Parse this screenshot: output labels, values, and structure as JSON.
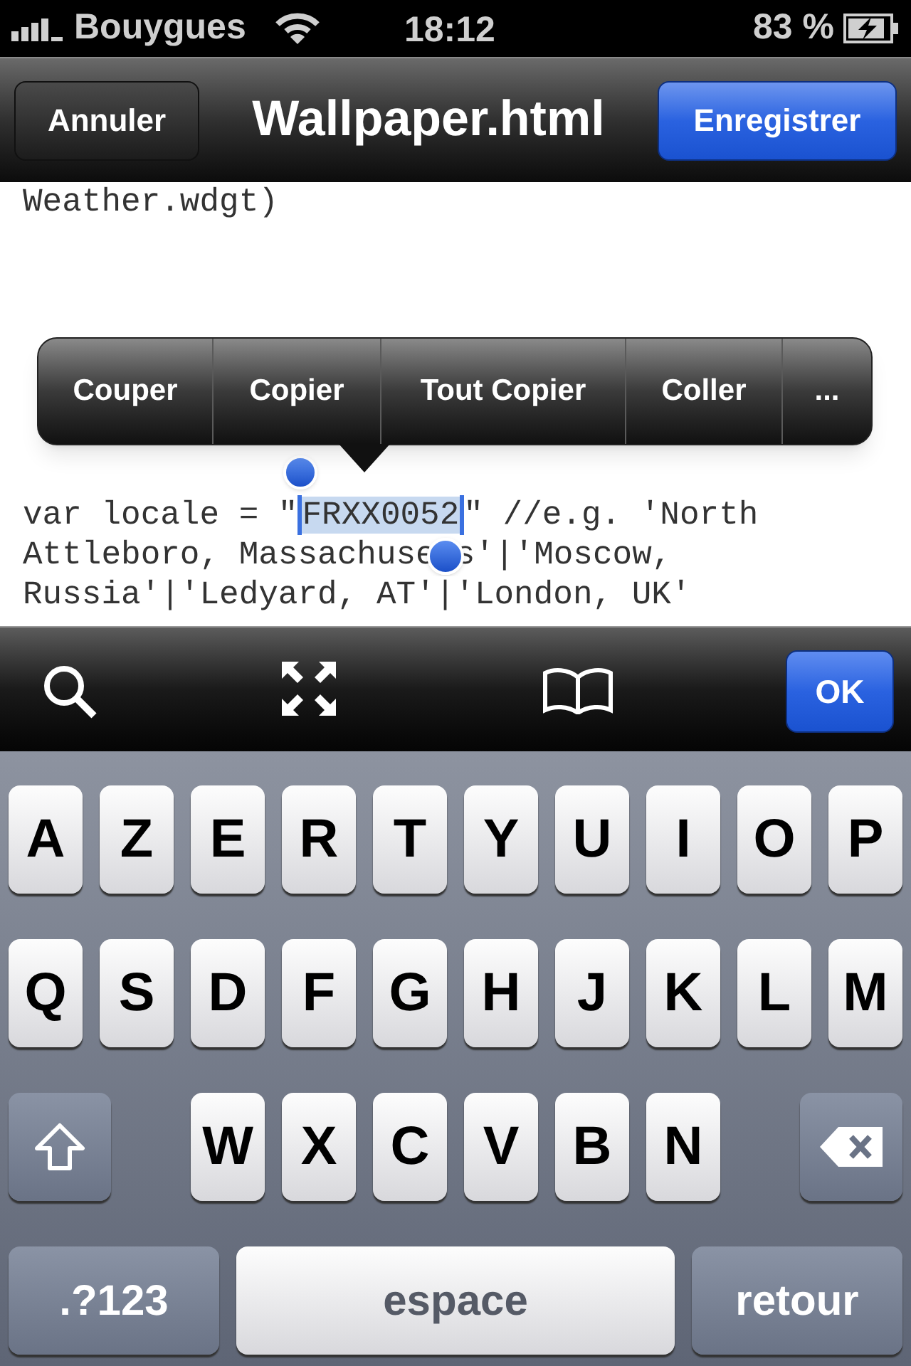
{
  "status_bar": {
    "carrier": "Bouygues",
    "time": "18:12",
    "battery": "83 %"
  },
  "nav_bar": {
    "cancel": "Annuler",
    "title": "Wallpaper.html",
    "save": "Enregistrer"
  },
  "code_blocks": [
    {
      "lines": [
        {
          "segments": [
            {
              "kind": "text",
              "text": "Weather.wdgt)",
              "selected": false
            }
          ]
        }
      ]
    },
    {
      "lines": [
        {
          "segments": [
            {
              "kind": "text",
              "text": "var locale = \"",
              "selected": false
            },
            {
              "kind": "start_handle"
            },
            {
              "kind": "text",
              "text": "FRXX0052",
              "selected": true
            },
            {
              "kind": "end_bar"
            },
            {
              "kind": "text",
              "text": "\" //e.g. 'North",
              "selected": false
            }
          ]
        },
        {
          "segments": [
            {
              "kind": "text",
              "text": "Attleboro, Massachuse",
              "selected": false
            },
            {
              "kind": "end_dot"
            },
            {
              "kind": "text",
              "text": "s'|'Moscow,",
              "selected": false
            }
          ]
        },
        {
          "segments": [
            {
              "kind": "text",
              "text": "Russia'|'Ledyard, AT'|'London, UK'",
              "selected": false
            }
          ]
        }
      ]
    }
  ],
  "edit_menu": {
    "items": [
      "Couper",
      "Copier",
      "Tout Copier",
      "Coller",
      "..."
    ]
  },
  "toolbar": {
    "ok": "OK"
  },
  "keyboard": {
    "rows": [
      {
        "keys": [
          {
            "kind": "letter",
            "label": "A"
          },
          {
            "kind": "letter",
            "label": "Z"
          },
          {
            "kind": "letter",
            "label": "E"
          },
          {
            "kind": "letter",
            "label": "R"
          },
          {
            "kind": "letter",
            "label": "T"
          },
          {
            "kind": "letter",
            "label": "Y"
          },
          {
            "kind": "letter",
            "label": "U"
          },
          {
            "kind": "letter",
            "label": "I"
          },
          {
            "kind": "letter",
            "label": "O"
          },
          {
            "kind": "letter",
            "label": "P"
          }
        ]
      },
      {
        "keys": [
          {
            "kind": "letter",
            "label": "Q"
          },
          {
            "kind": "letter",
            "label": "S"
          },
          {
            "kind": "letter",
            "label": "D"
          },
          {
            "kind": "letter",
            "label": "F"
          },
          {
            "kind": "letter",
            "label": "G"
          },
          {
            "kind": "letter",
            "label": "H"
          },
          {
            "kind": "letter",
            "label": "J"
          },
          {
            "kind": "letter",
            "label": "K"
          },
          {
            "kind": "letter",
            "label": "L"
          },
          {
            "kind": "letter",
            "label": "M"
          }
        ]
      },
      {
        "keys": [
          {
            "kind": "shift"
          },
          {
            "kind": "letter",
            "label": "W"
          },
          {
            "kind": "letter",
            "label": "X"
          },
          {
            "kind": "letter",
            "label": "C"
          },
          {
            "kind": "letter",
            "label": "V"
          },
          {
            "kind": "letter",
            "label": "B"
          },
          {
            "kind": "letter",
            "label": "N"
          },
          {
            "kind": "delete"
          }
        ]
      },
      {
        "keys": [
          {
            "kind": "mode",
            "label": ".?123"
          },
          {
            "kind": "space",
            "label": "espace"
          },
          {
            "kind": "return",
            "label": "retour"
          }
        ]
      }
    ]
  }
}
